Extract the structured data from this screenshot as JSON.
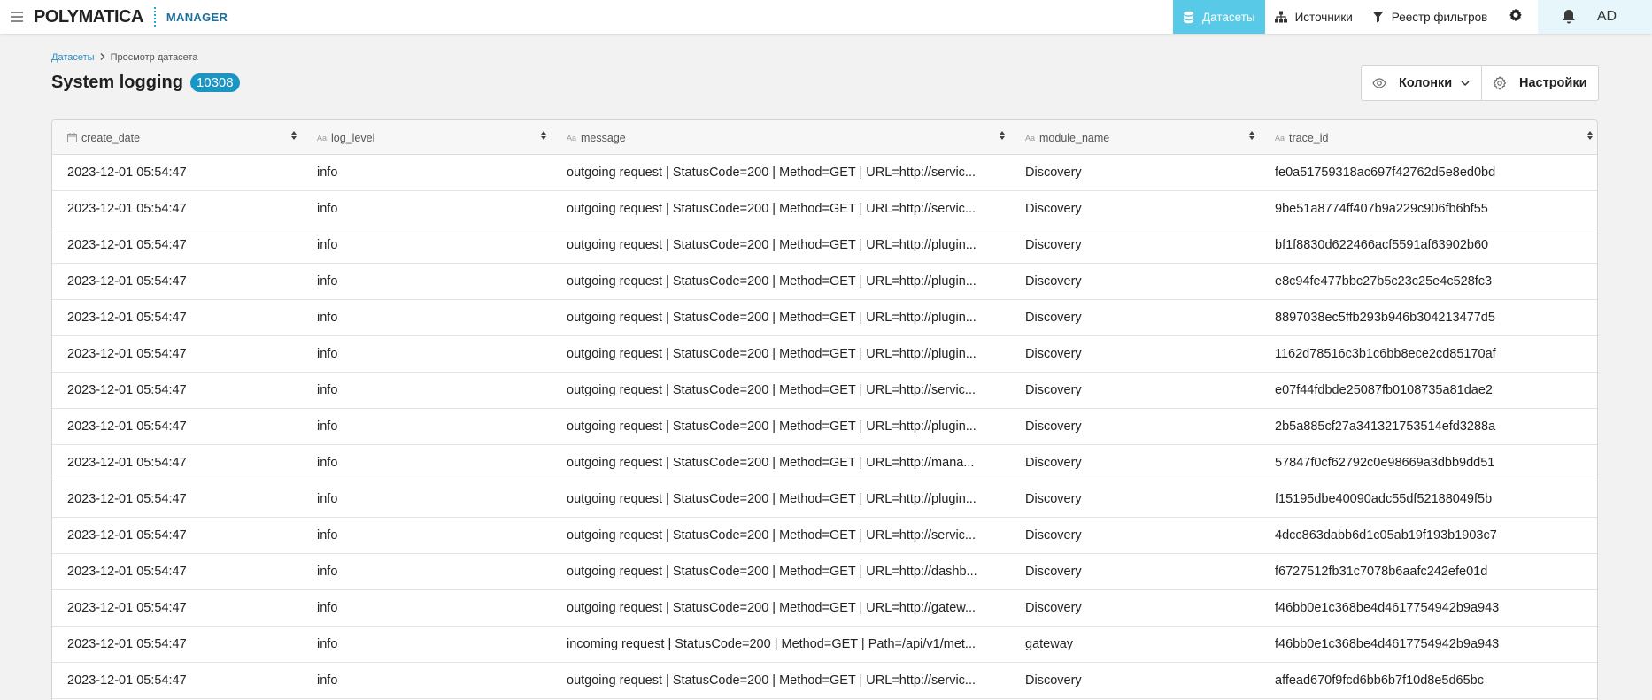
{
  "brand": {
    "logo": "POLYMATICA",
    "product": "MANAGER"
  },
  "nav": {
    "items": [
      {
        "label": "Датасеты",
        "active": true,
        "icon": "database-icon"
      },
      {
        "label": "Источники",
        "active": false,
        "icon": "sitemap-icon"
      },
      {
        "label": "Реестр фильтров",
        "active": false,
        "icon": "filter-icon"
      }
    ],
    "settings_icon": "gear-icon"
  },
  "user": {
    "initials": "AD"
  },
  "breadcrumb": {
    "root": "Датасеты",
    "current": "Просмотр датасета"
  },
  "page": {
    "title": "System logging",
    "count": "10308"
  },
  "toolbar": {
    "columns_label": "Колонки",
    "settings_label": "Настройки"
  },
  "colors": {
    "accent": "#58c9e6",
    "badge": "#1a96c4",
    "link": "#2a8fc4"
  },
  "table": {
    "columns": [
      {
        "name": "create_date",
        "type": "date"
      },
      {
        "name": "log_level",
        "type": "Aa"
      },
      {
        "name": "message",
        "type": "Aa"
      },
      {
        "name": "module_name",
        "type": "Aa"
      },
      {
        "name": "trace_id",
        "type": "Aa"
      }
    ],
    "rows": [
      [
        "2023-12-01 05:54:47",
        "info",
        "outgoing request | StatusCode=200 | Method=GET | URL=http://servic...",
        "Discovery",
        "fe0a51759318ac697f42762d5e8ed0bd"
      ],
      [
        "2023-12-01 05:54:47",
        "info",
        "outgoing request | StatusCode=200 | Method=GET | URL=http://servic...",
        "Discovery",
        "9be51a8774ff407b9a229c906fb6bf55"
      ],
      [
        "2023-12-01 05:54:47",
        "info",
        "outgoing request | StatusCode=200 | Method=GET | URL=http://plugin...",
        "Discovery",
        "bf1f8830d622466acf5591af63902b60"
      ],
      [
        "2023-12-01 05:54:47",
        "info",
        "outgoing request | StatusCode=200 | Method=GET | URL=http://plugin...",
        "Discovery",
        "e8c94fe477bbc27b5c23c25e4c528fc3"
      ],
      [
        "2023-12-01 05:54:47",
        "info",
        "outgoing request | StatusCode=200 | Method=GET | URL=http://plugin...",
        "Discovery",
        "8897038ec5ffb293b946b304213477d5"
      ],
      [
        "2023-12-01 05:54:47",
        "info",
        "outgoing request | StatusCode=200 | Method=GET | URL=http://plugin...",
        "Discovery",
        "1162d78516c3b1c6bb8ece2cd85170af"
      ],
      [
        "2023-12-01 05:54:47",
        "info",
        "outgoing request | StatusCode=200 | Method=GET | URL=http://servic...",
        "Discovery",
        "e07f44fdbde25087fb0108735a81dae2"
      ],
      [
        "2023-12-01 05:54:47",
        "info",
        "outgoing request | StatusCode=200 | Method=GET | URL=http://plugin...",
        "Discovery",
        "2b5a885cf27a341321753514efd3288a"
      ],
      [
        "2023-12-01 05:54:47",
        "info",
        "outgoing request | StatusCode=200 | Method=GET | URL=http://mana...",
        "Discovery",
        "57847f0cf62792c0e98669a3dbb9dd51"
      ],
      [
        "2023-12-01 05:54:47",
        "info",
        "outgoing request | StatusCode=200 | Method=GET | URL=http://plugin...",
        "Discovery",
        "f15195dbe40090adc55df52188049f5b"
      ],
      [
        "2023-12-01 05:54:47",
        "info",
        "outgoing request | StatusCode=200 | Method=GET | URL=http://servic...",
        "Discovery",
        "4dcc863dabb6d1c05ab19f193b1903c7"
      ],
      [
        "2023-12-01 05:54:47",
        "info",
        "outgoing request | StatusCode=200 | Method=GET | URL=http://dashb...",
        "Discovery",
        "f6727512fb31c7078b6aafc242efe01d"
      ],
      [
        "2023-12-01 05:54:47",
        "info",
        "outgoing request | StatusCode=200 | Method=GET | URL=http://gatew...",
        "Discovery",
        "f46bb0e1c368be4d4617754942b9a943"
      ],
      [
        "2023-12-01 05:54:47",
        "info",
        "incoming request | StatusCode=200 | Method=GET | Path=/api/v1/met...",
        "gateway",
        "f46bb0e1c368be4d4617754942b9a943"
      ],
      [
        "2023-12-01 05:54:47",
        "info",
        "outgoing request | StatusCode=200 | Method=GET | URL=http://servic...",
        "Discovery",
        "affead670f9fcd6bb6b7f10d8e5d65bc"
      ]
    ]
  }
}
